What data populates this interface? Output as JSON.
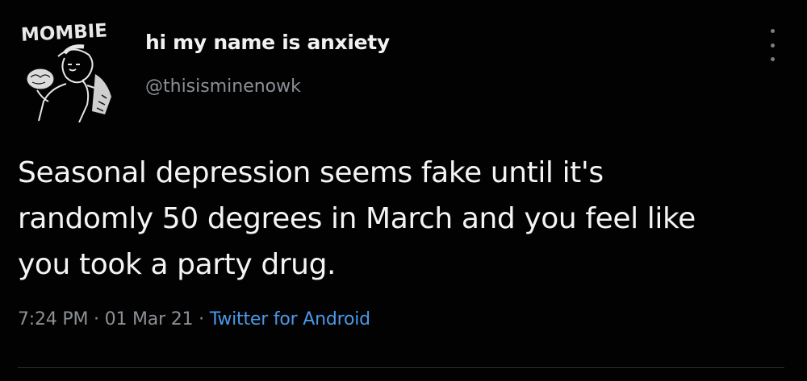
{
  "tweet": {
    "display_name": "hi my name is anxiety",
    "handle": "@thisisminenowk",
    "avatar_text": "MOMBIE",
    "text": "Seasonal depression seems fake until it's\nrandomly 50 degrees in March and you feel like\nyou took a party drug.",
    "time": "7:24 PM",
    "separator": " · ",
    "date": "01 Mar 21",
    "source": "Twitter for Android"
  },
  "icons": {
    "more": "more-vertical-icon"
  },
  "colors": {
    "background": "#020202",
    "text": "#f4f4f4",
    "secondary": "#8b9096",
    "link": "#4a99e9"
  }
}
